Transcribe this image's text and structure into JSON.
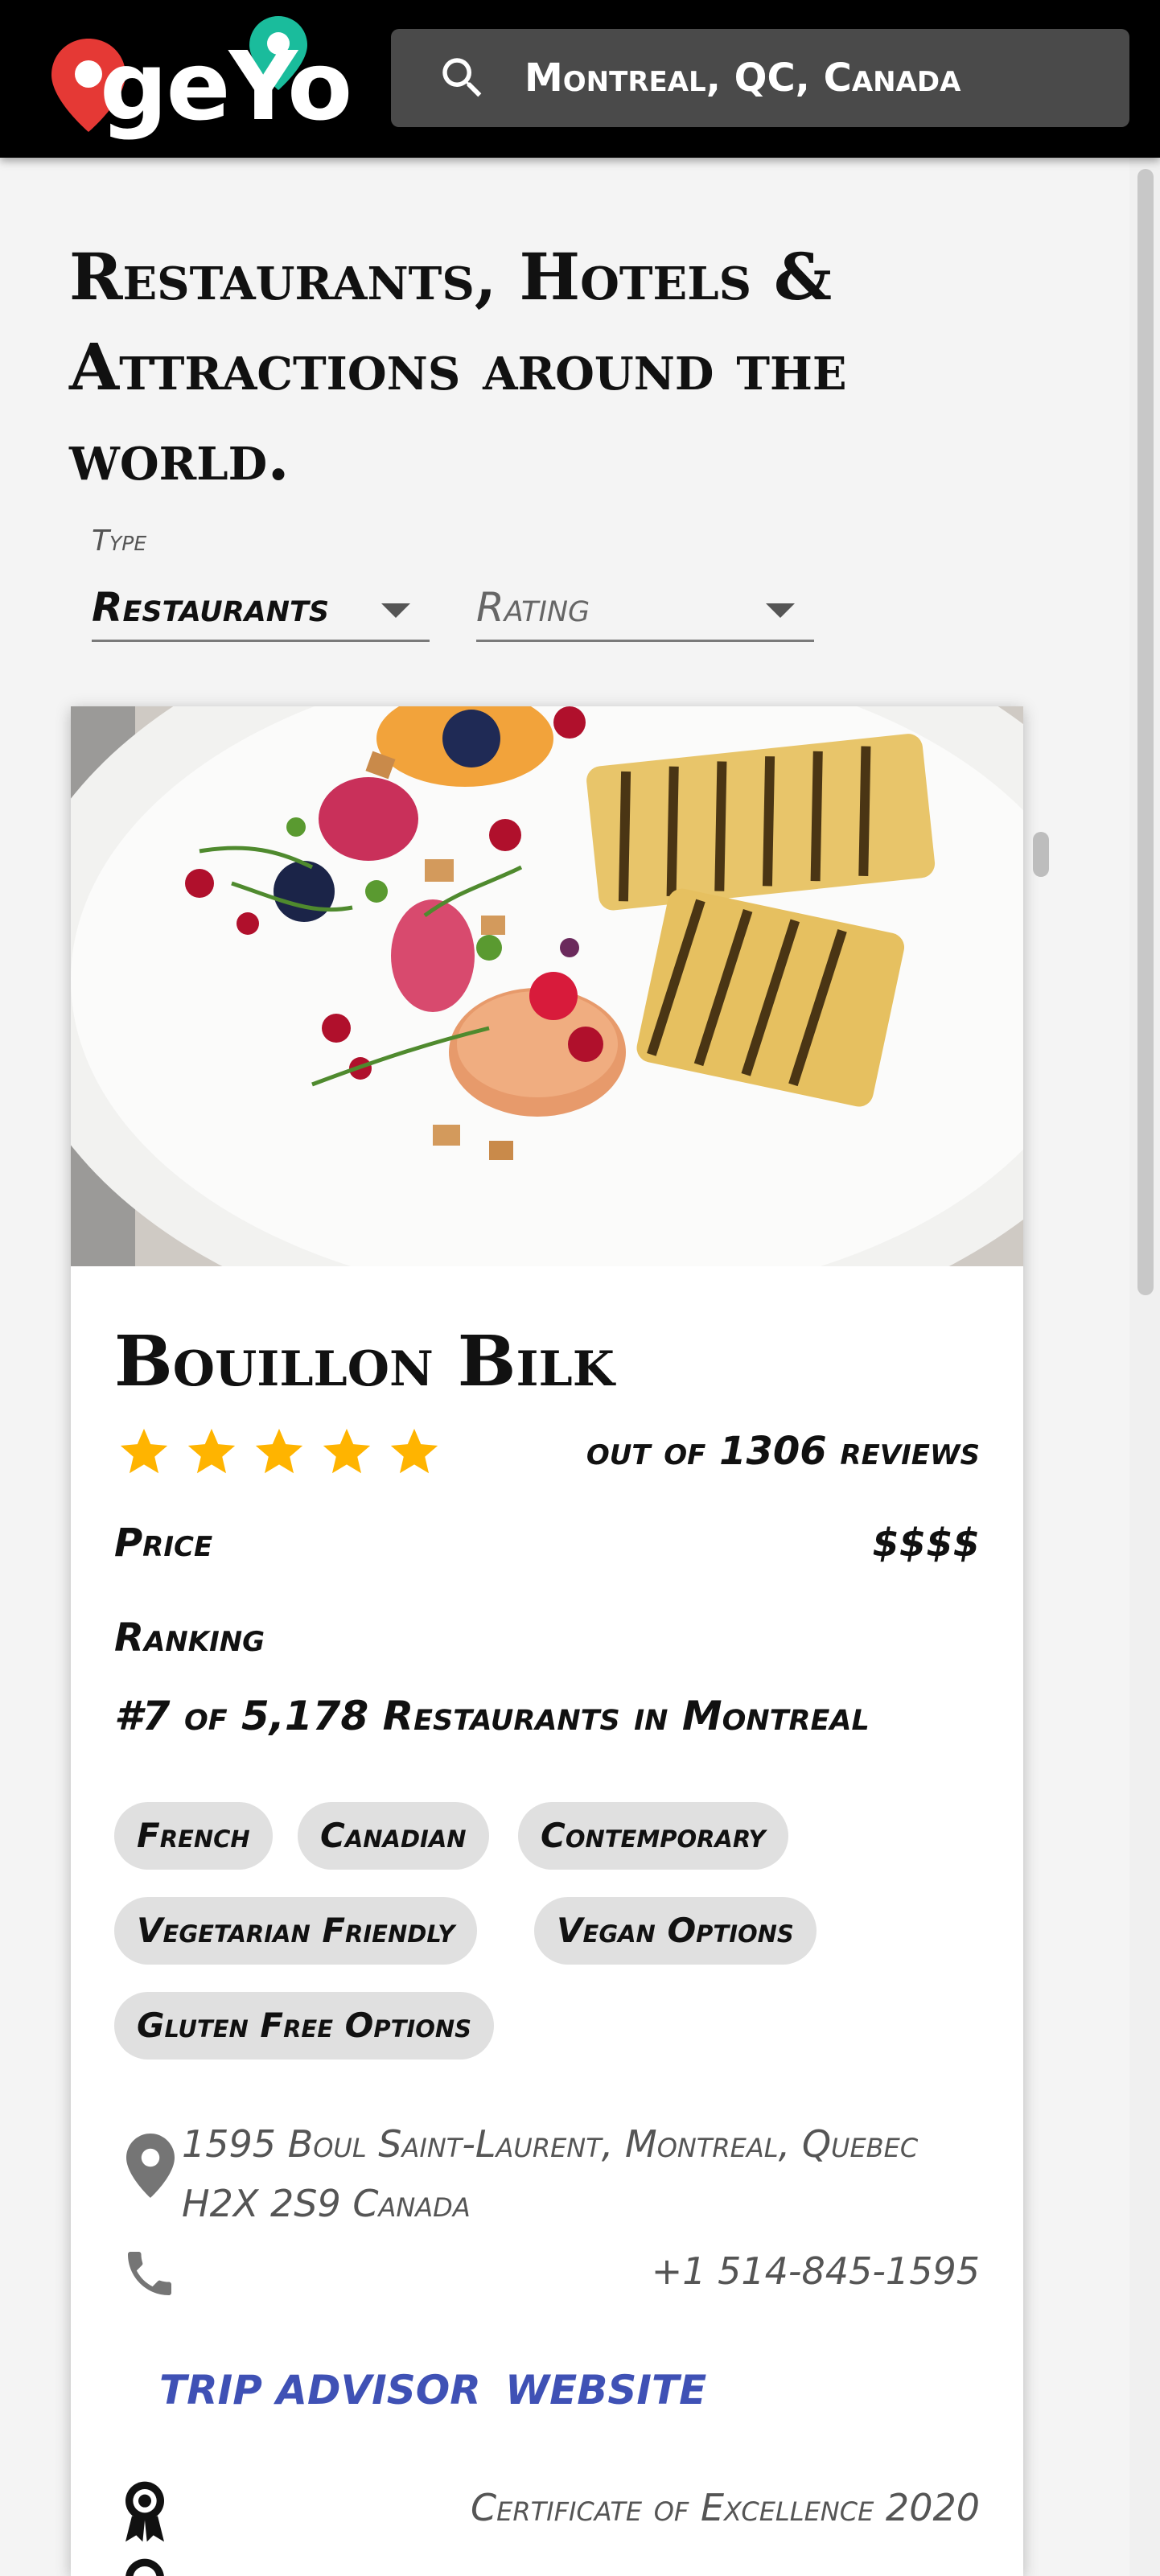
{
  "header": {
    "logo_text": "geYo",
    "search_value": "Montreal, QC, Canada"
  },
  "page": {
    "title": "Restaurants, Hotels & Attractions around the world."
  },
  "filters": {
    "type_label": "Type",
    "type_value": "Restaurants",
    "rating_placeholder": "Rating"
  },
  "card": {
    "name": "Bouillon Bilk",
    "rating": 5,
    "reviews": "out of 1306 reviews",
    "price_label": "Price",
    "price_value": "$$$$",
    "ranking_label": "Ranking",
    "ranking_value": "#7 of 5,178 Restaurants in Montreal",
    "cuisines": [
      "French",
      "Canadian",
      "Contemporary",
      "Vegetarian Friendly",
      "Vegan Options",
      "Gluten Free Options"
    ],
    "address": "1595 Boul Saint-Laurent, Montreal, Quebec H2X 2S9 Canada",
    "phone": "+1 514-845-1595",
    "link_tripadvisor": "TRIP ADVISOR",
    "link_website": "WEBSITE",
    "awards": [
      "Certificate of Excellence 2020"
    ]
  },
  "colors": {
    "header_bg": "#000000",
    "star": "#ffb400",
    "link": "#3f51b5",
    "pin_red": "#e53935",
    "pin_teal": "#1abc9c"
  },
  "icons": [
    "search-icon",
    "star-icon",
    "location-pin-icon",
    "phone-icon",
    "award-icon",
    "dropdown-caret-icon"
  ]
}
